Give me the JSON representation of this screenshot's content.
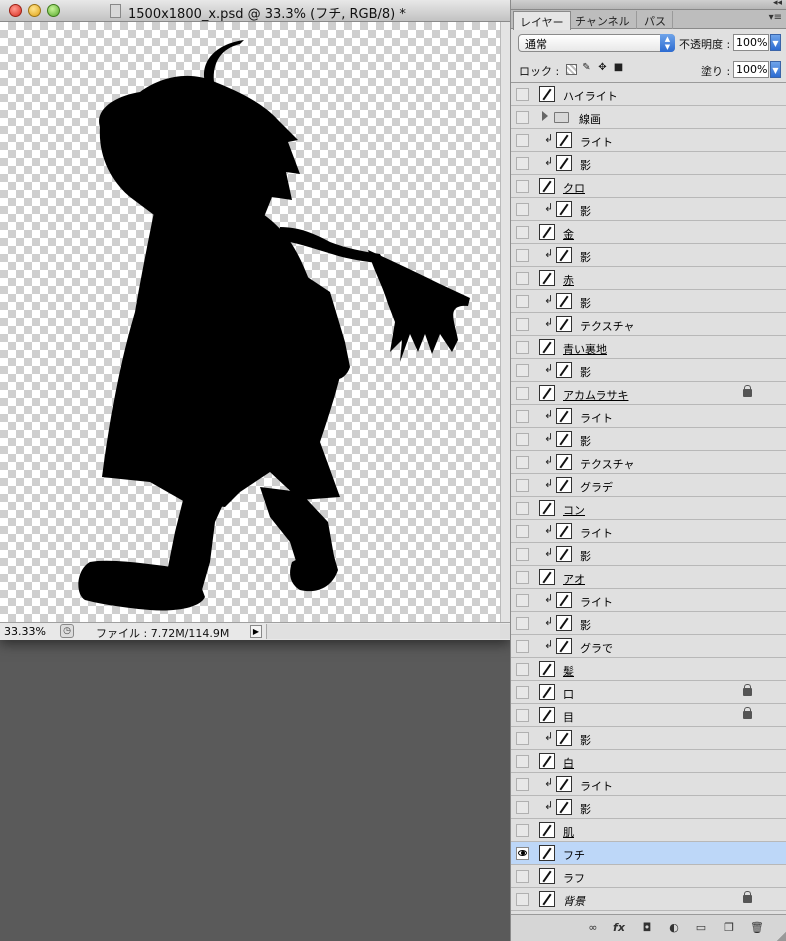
{
  "document": {
    "title": "1500x1800_x.psd @ 33.3% (フチ, RGB/8) *",
    "zoom": "33.33%",
    "file_info": "ファイル : 7.72M/114.9M"
  },
  "panel": {
    "tabs": [
      {
        "label": "レイヤー",
        "active": true
      },
      {
        "label": "チャンネル",
        "active": false
      },
      {
        "label": "パス",
        "active": false
      }
    ],
    "blend_mode": "通常",
    "opacity_label": "不透明度 :",
    "opacity_value": "100%",
    "lock_label": "ロック :",
    "fill_label": "塗り :",
    "fill_value": "100%"
  },
  "layers": [
    {
      "name": "ハイライト",
      "kind": "layer",
      "clipped": false,
      "visible": false,
      "underline": false,
      "locked": false,
      "selected": false
    },
    {
      "name": "線画",
      "kind": "group",
      "clipped": false,
      "visible": false,
      "underline": false,
      "locked": false,
      "selected": false
    },
    {
      "name": "ライト",
      "kind": "layer",
      "clipped": true,
      "visible": false,
      "underline": false,
      "locked": false,
      "selected": false
    },
    {
      "name": "影",
      "kind": "layer",
      "clipped": true,
      "visible": false,
      "underline": false,
      "locked": false,
      "selected": false
    },
    {
      "name": "クロ",
      "kind": "layer",
      "clipped": false,
      "visible": false,
      "underline": true,
      "locked": false,
      "selected": false
    },
    {
      "name": "影",
      "kind": "layer",
      "clipped": true,
      "visible": false,
      "underline": false,
      "locked": false,
      "selected": false
    },
    {
      "name": "金",
      "kind": "layer",
      "clipped": false,
      "visible": false,
      "underline": true,
      "locked": false,
      "selected": false
    },
    {
      "name": "影",
      "kind": "layer",
      "clipped": true,
      "visible": false,
      "underline": false,
      "locked": false,
      "selected": false
    },
    {
      "name": "赤",
      "kind": "layer",
      "clipped": false,
      "visible": false,
      "underline": true,
      "locked": false,
      "selected": false
    },
    {
      "name": "影",
      "kind": "layer",
      "clipped": true,
      "visible": false,
      "underline": false,
      "locked": false,
      "selected": false
    },
    {
      "name": "テクスチャ",
      "kind": "layer",
      "clipped": true,
      "visible": false,
      "underline": false,
      "locked": false,
      "selected": false
    },
    {
      "name": "青い裏地",
      "kind": "layer",
      "clipped": false,
      "visible": false,
      "underline": true,
      "locked": false,
      "selected": false
    },
    {
      "name": "影",
      "kind": "layer",
      "clipped": true,
      "visible": false,
      "underline": false,
      "locked": false,
      "selected": false
    },
    {
      "name": "アカムラサキ",
      "kind": "layer",
      "clipped": false,
      "visible": false,
      "underline": true,
      "locked": true,
      "selected": false
    },
    {
      "name": "ライト",
      "kind": "layer",
      "clipped": true,
      "visible": false,
      "underline": false,
      "locked": false,
      "selected": false
    },
    {
      "name": "影",
      "kind": "layer",
      "clipped": true,
      "visible": false,
      "underline": false,
      "locked": false,
      "selected": false
    },
    {
      "name": "テクスチャ",
      "kind": "layer",
      "clipped": true,
      "visible": false,
      "underline": false,
      "locked": false,
      "selected": false
    },
    {
      "name": "グラデ",
      "kind": "layer",
      "clipped": true,
      "visible": false,
      "underline": false,
      "locked": false,
      "selected": false
    },
    {
      "name": "コン",
      "kind": "layer",
      "clipped": false,
      "visible": false,
      "underline": true,
      "locked": false,
      "selected": false
    },
    {
      "name": "ライト",
      "kind": "layer",
      "clipped": true,
      "visible": false,
      "underline": false,
      "locked": false,
      "selected": false
    },
    {
      "name": "影",
      "kind": "layer",
      "clipped": true,
      "visible": false,
      "underline": false,
      "locked": false,
      "selected": false
    },
    {
      "name": "アオ",
      "kind": "layer",
      "clipped": false,
      "visible": false,
      "underline": true,
      "locked": false,
      "selected": false
    },
    {
      "name": "ライト",
      "kind": "layer",
      "clipped": true,
      "visible": false,
      "underline": false,
      "locked": false,
      "selected": false
    },
    {
      "name": "影",
      "kind": "layer",
      "clipped": true,
      "visible": false,
      "underline": false,
      "locked": false,
      "selected": false
    },
    {
      "name": "グラで",
      "kind": "layer",
      "clipped": true,
      "visible": false,
      "underline": false,
      "locked": false,
      "selected": false
    },
    {
      "name": "髪",
      "kind": "layer",
      "clipped": false,
      "visible": false,
      "underline": true,
      "locked": false,
      "selected": false
    },
    {
      "name": "口",
      "kind": "layer",
      "clipped": false,
      "visible": false,
      "underline": false,
      "locked": true,
      "selected": false
    },
    {
      "name": "目",
      "kind": "layer",
      "clipped": false,
      "visible": false,
      "underline": false,
      "locked": true,
      "selected": false
    },
    {
      "name": "影",
      "kind": "layer",
      "clipped": true,
      "visible": false,
      "underline": false,
      "locked": false,
      "selected": false
    },
    {
      "name": "白",
      "kind": "layer",
      "clipped": false,
      "visible": false,
      "underline": true,
      "locked": false,
      "selected": false
    },
    {
      "name": "ライト",
      "kind": "layer",
      "clipped": true,
      "visible": false,
      "underline": false,
      "locked": false,
      "selected": false
    },
    {
      "name": "影",
      "kind": "layer",
      "clipped": true,
      "visible": false,
      "underline": false,
      "locked": false,
      "selected": false
    },
    {
      "name": "肌",
      "kind": "layer",
      "clipped": false,
      "visible": false,
      "underline": true,
      "locked": false,
      "selected": false
    },
    {
      "name": "フチ",
      "kind": "layer",
      "clipped": false,
      "visible": true,
      "underline": false,
      "locked": false,
      "selected": true
    },
    {
      "name": "ラフ",
      "kind": "layer",
      "clipped": false,
      "visible": false,
      "underline": false,
      "locked": false,
      "selected": false
    },
    {
      "name": "背景",
      "kind": "layer",
      "clipped": false,
      "visible": false,
      "underline": false,
      "locked": true,
      "selected": false,
      "italic": true
    }
  ],
  "colors": {
    "selected_row": "#bdd7f8",
    "panel_bg": "#e0e0e0",
    "workspace_bg": "#5a5a5a"
  },
  "bottom_icons": [
    "link-icon",
    "fx-icon",
    "mask-icon",
    "adjustment-icon",
    "folder-icon",
    "new-layer-icon",
    "trash-icon"
  ]
}
